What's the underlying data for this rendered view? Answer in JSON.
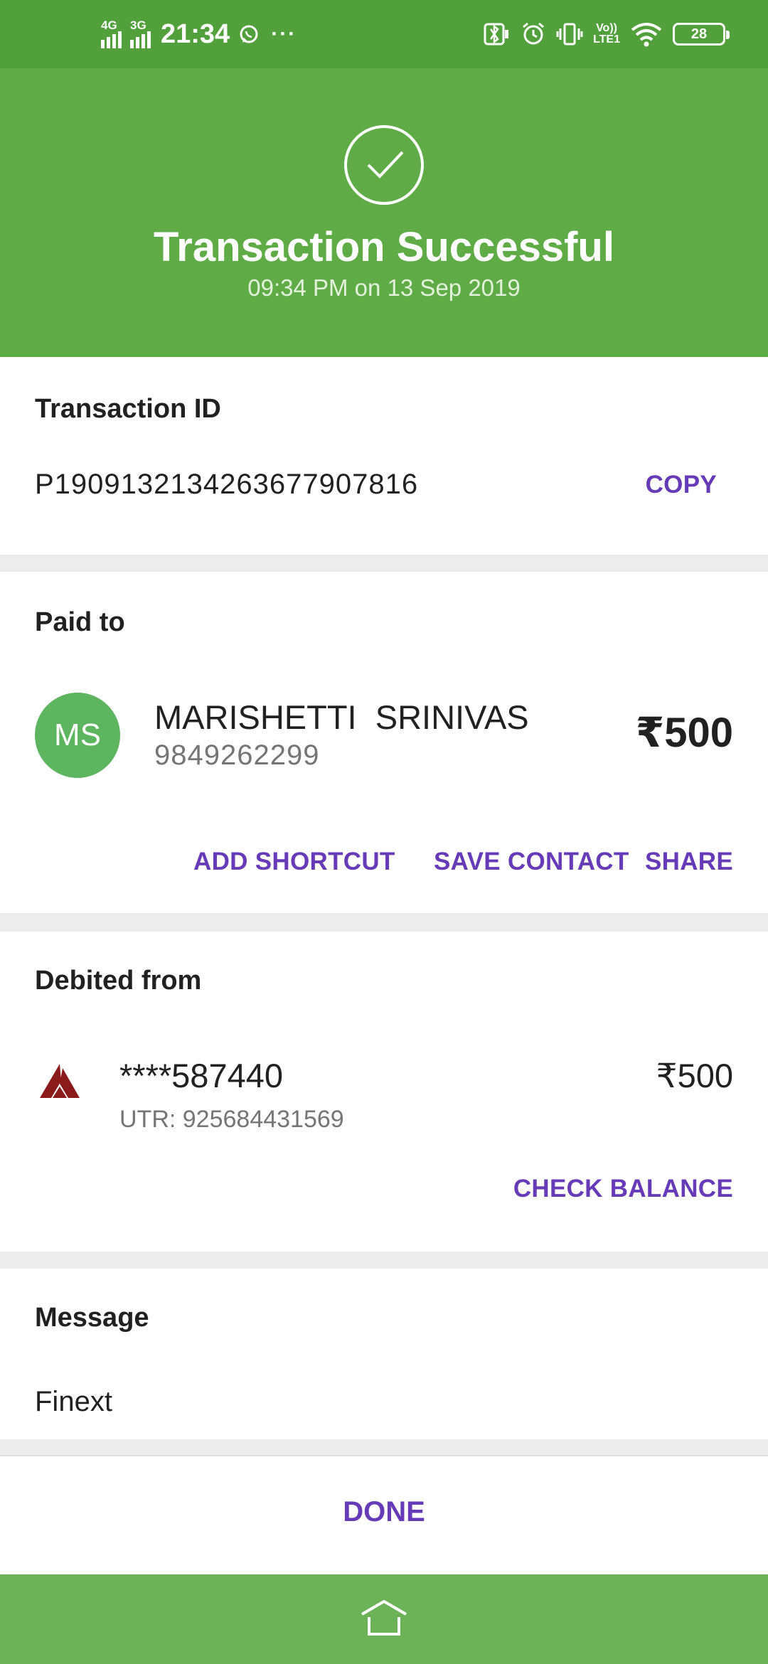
{
  "status_bar": {
    "time": "21:34",
    "signal1_tag": "4G",
    "signal2_tag": "3G",
    "more_indicator": "···",
    "volte_line1": "Vo))",
    "volte_line2": "LTE1",
    "battery_level": "28",
    "icons": [
      "whatsapp-icon",
      "bluetooth-icon",
      "alarm-icon",
      "vibrate-icon",
      "wifi-icon",
      "battery-icon"
    ]
  },
  "header": {
    "title": "Transaction Successful",
    "subtitle": "09:34 PM on 13 Sep 2019",
    "background": "#5fac47"
  },
  "transaction": {
    "label": "Transaction ID",
    "id": "P1909132134263677907816",
    "copy_label": "COPY"
  },
  "paid_to": {
    "label": "Paid to",
    "initials": "MS",
    "name": "MARISHETTI  SRINIVAS",
    "phone": "9849262299",
    "amount": "₹500",
    "actions": {
      "add_shortcut": "ADD SHORTCUT",
      "save_contact": "SAVE CONTACT",
      "share": "SHARE"
    }
  },
  "debited_from": {
    "label": "Debited from",
    "account": "****587440",
    "utr": "UTR: 925684431569",
    "amount": "₹500",
    "check_balance": "CHECK BALANCE",
    "bank_icon": "axis-bank-logo"
  },
  "message": {
    "label": "Message",
    "text": "Finext"
  },
  "footer": {
    "done_label": "DONE"
  },
  "colors": {
    "accent": "#673ab7",
    "success": "#5fac47",
    "avatar": "#5eb55f",
    "bank": "#8b1a1a"
  }
}
